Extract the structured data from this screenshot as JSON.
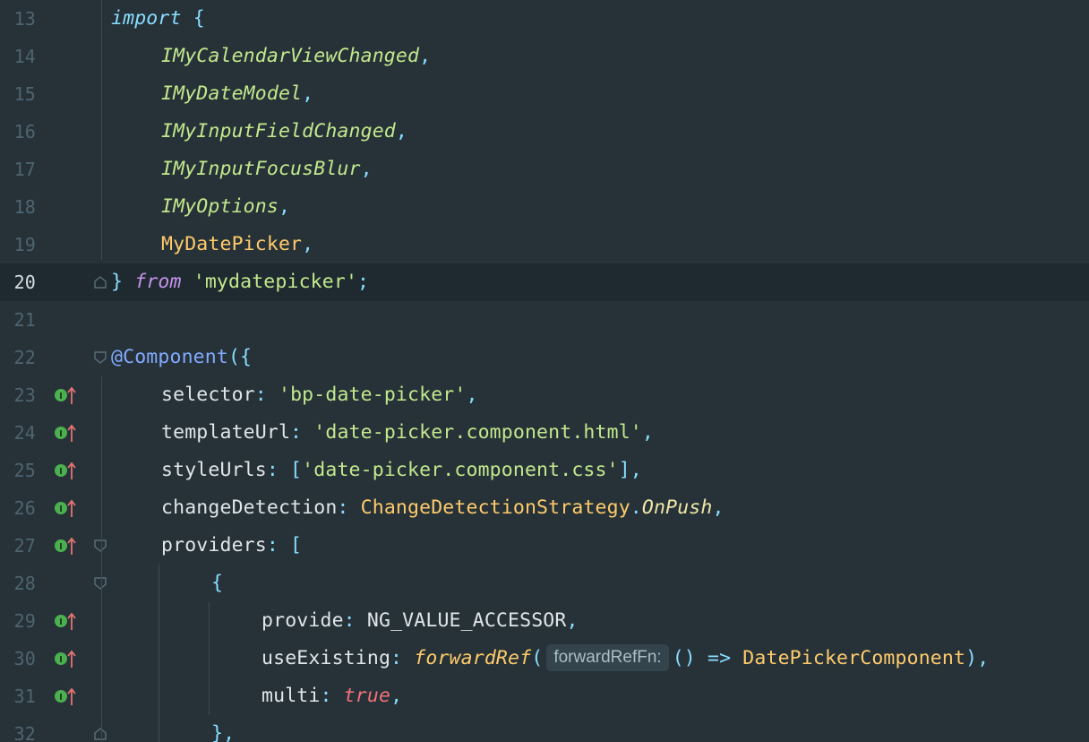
{
  "editor": {
    "lines": [
      {
        "num": "13",
        "tokens": [
          [
            "kw",
            "import"
          ],
          [
            "plain",
            " "
          ],
          [
            "punc",
            "{"
          ]
        ]
      },
      {
        "num": "14",
        "tokens": [
          [
            "iface",
            "IMyCalendarViewChanged"
          ],
          [
            "punc",
            ","
          ]
        ]
      },
      {
        "num": "15",
        "tokens": [
          [
            "iface",
            "IMyDateModel"
          ],
          [
            "punc",
            ","
          ]
        ]
      },
      {
        "num": "16",
        "tokens": [
          [
            "iface",
            "IMyInputFieldChanged"
          ],
          [
            "punc",
            ","
          ]
        ]
      },
      {
        "num": "17",
        "tokens": [
          [
            "iface",
            "IMyInputFocusBlur"
          ],
          [
            "punc",
            ","
          ]
        ]
      },
      {
        "num": "18",
        "tokens": [
          [
            "iface",
            "IMyOptions"
          ],
          [
            "punc",
            ","
          ]
        ]
      },
      {
        "num": "19",
        "tokens": [
          [
            "cls",
            "MyDatePicker"
          ],
          [
            "punc",
            ","
          ]
        ]
      },
      {
        "num": "20",
        "tokens": [
          [
            "punc",
            "}"
          ],
          [
            "plain",
            " "
          ],
          [
            "kw2",
            "from"
          ],
          [
            "plain",
            " "
          ],
          [
            "str",
            "'mydatepicker'"
          ],
          [
            "punc",
            ";"
          ]
        ]
      },
      {
        "num": "21",
        "tokens": []
      },
      {
        "num": "22",
        "tokens": [
          [
            "dec",
            "@Component"
          ],
          [
            "punc",
            "({"
          ]
        ]
      },
      {
        "num": "23",
        "tokens": [
          [
            "prop",
            "selector"
          ],
          [
            "punc",
            ": "
          ],
          [
            "str",
            "'bp-date-picker'"
          ],
          [
            "punc",
            ","
          ]
        ]
      },
      {
        "num": "24",
        "tokens": [
          [
            "prop",
            "templateUrl"
          ],
          [
            "punc",
            ": "
          ],
          [
            "str",
            "'date-picker.component.html'"
          ],
          [
            "punc",
            ","
          ]
        ]
      },
      {
        "num": "25",
        "tokens": [
          [
            "prop",
            "styleUrls"
          ],
          [
            "punc",
            ": ["
          ],
          [
            "str",
            "'date-picker.component.css'"
          ],
          [
            "punc",
            "],"
          ]
        ]
      },
      {
        "num": "26",
        "tokens": [
          [
            "prop",
            "changeDetection"
          ],
          [
            "punc",
            ": "
          ],
          [
            "cls",
            "ChangeDetectionStrategy"
          ],
          [
            "punc",
            "."
          ],
          [
            "ital",
            "OnPush"
          ],
          [
            "punc",
            ","
          ]
        ]
      },
      {
        "num": "27",
        "tokens": [
          [
            "prop",
            "providers"
          ],
          [
            "punc",
            ": ["
          ]
        ]
      },
      {
        "num": "28",
        "tokens": [
          [
            "punc",
            "{"
          ]
        ]
      },
      {
        "num": "29",
        "tokens": [
          [
            "prop",
            "provide"
          ],
          [
            "punc",
            ": "
          ],
          [
            "plain",
            "NG_VALUE_ACCESSOR"
          ],
          [
            "punc",
            ","
          ]
        ]
      },
      {
        "num": "30",
        "tokens": [
          [
            "prop",
            "useExisting"
          ],
          [
            "punc",
            ": "
          ],
          [
            "fn",
            "forwardRef"
          ],
          [
            "punc",
            "("
          ],
          [
            "hint",
            "forwardRefFn:"
          ],
          [
            "punc",
            "() "
          ],
          [
            "arrow",
            "=>"
          ],
          [
            "plain",
            " "
          ],
          [
            "cls",
            "DatePickerComponent"
          ],
          [
            "punc",
            "),"
          ]
        ]
      },
      {
        "num": "31",
        "tokens": [
          [
            "prop",
            "multi"
          ],
          [
            "punc",
            ": "
          ],
          [
            "bool",
            "true"
          ],
          [
            "punc",
            ","
          ]
        ]
      },
      {
        "num": "32",
        "tokens": [
          [
            "punc",
            "},"
          ]
        ]
      }
    ]
  },
  "colors": {
    "background": "#263238",
    "current_line": "#1e2a30",
    "marker_green": "#4caf50",
    "marker_red": "#e57373"
  },
  "icons": {
    "gutter_marker": "implements-up-arrow-icon",
    "fold": "fold-marker-icon"
  }
}
